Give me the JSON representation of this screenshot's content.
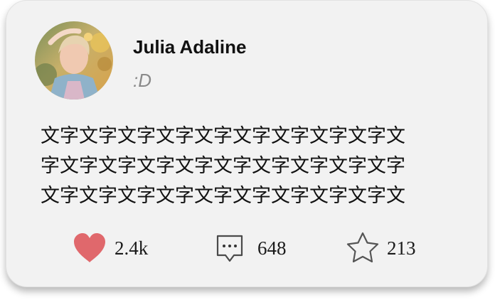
{
  "post": {
    "author_name": "Julia Adaline",
    "status": ":D",
    "body_lines": [
      "文字文字文字文字文字文字文字文字文字文",
      "字文字文字文字文字文字文字文字文字文字",
      "文字文字文字文字文字文字文字文字文字文"
    ]
  },
  "actions": {
    "likes": "2.4k",
    "comments": "648",
    "favorites": "213"
  },
  "icons": {
    "like": "heart-icon",
    "comment": "comment-icon",
    "favorite": "star-icon"
  },
  "colors": {
    "card_background": "#f2f2f2",
    "heart": "#e0686c",
    "text": "#111111",
    "muted": "#8a8a8a"
  }
}
